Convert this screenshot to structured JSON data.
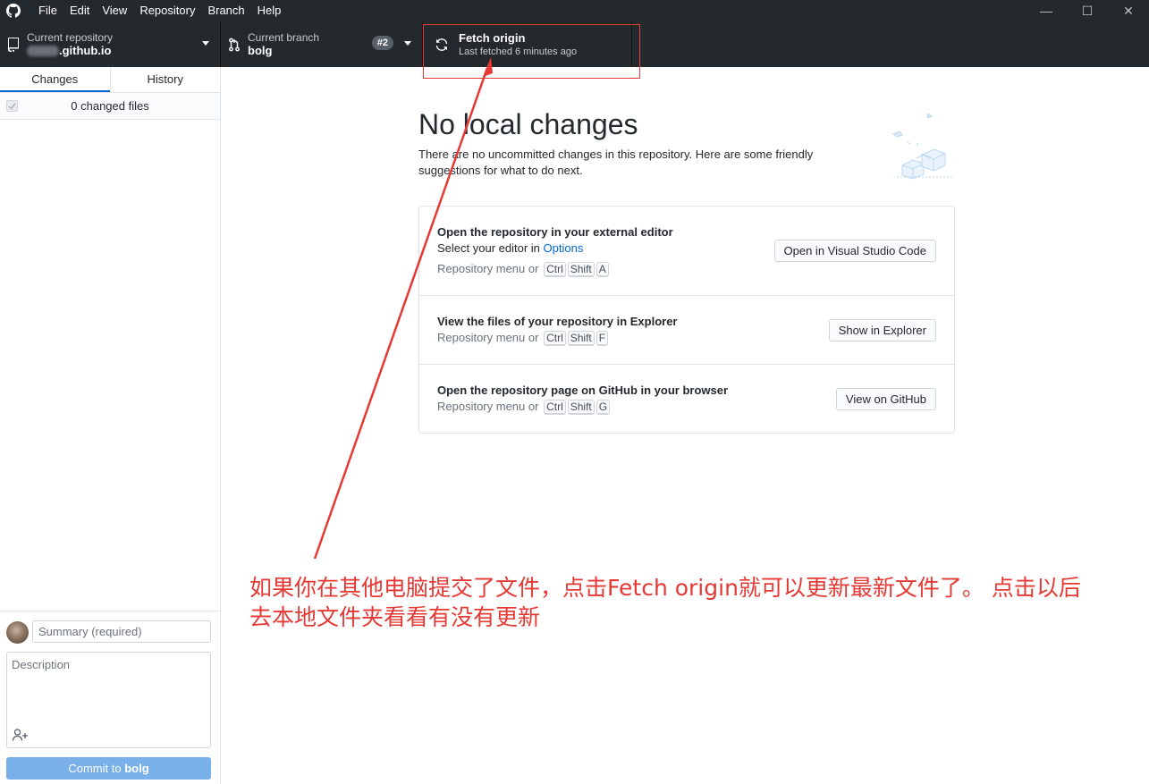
{
  "menu": [
    "File",
    "Edit",
    "View",
    "Repository",
    "Branch",
    "Help"
  ],
  "window_controls": {
    "minimize": "—",
    "maximize": "☐",
    "close": "✕"
  },
  "toolbar": {
    "repo_label": "Current repository",
    "repo_name": ".github.io",
    "branch_label": "Current branch",
    "branch_name": "bolg",
    "pr_badge": "#2",
    "fetch_title": "Fetch origin",
    "fetch_sub": "Last fetched 6 minutes ago"
  },
  "sidebar": {
    "tabs": [
      "Changes",
      "History"
    ],
    "changed_files": "0 changed files",
    "summary_placeholder": "Summary (required)",
    "description_placeholder": "Description",
    "commit_prefix": "Commit to ",
    "commit_branch": "bolg"
  },
  "main": {
    "heading": "No local changes",
    "subtext": "There are no uncommitted changes in this repository. Here are some friendly suggestions for what to do next.",
    "actions": [
      {
        "title": "Open the repository in your external editor",
        "desc_prefix": "Select your editor in ",
        "desc_link": "Options",
        "shortcut_prefix": "Repository menu or",
        "keys": [
          "Ctrl",
          "Shift",
          "A"
        ],
        "button": "Open in Visual Studio Code"
      },
      {
        "title": "View the files of your repository in Explorer",
        "shortcut_prefix": "Repository menu or",
        "keys": [
          "Ctrl",
          "Shift",
          "F"
        ],
        "button": "Show in Explorer"
      },
      {
        "title": "Open the repository page on GitHub in your browser",
        "shortcut_prefix": "Repository menu or",
        "keys": [
          "Ctrl",
          "Shift",
          "G"
        ],
        "button": "View on GitHub"
      }
    ]
  },
  "annotation": {
    "text": "如果你在其他电脑提交了文件，点击Fetch origin就可以更新最新文件了。 点击以后\n去本地文件夹看看有没有更新",
    "color": "#e53935"
  },
  "colors": {
    "toolbar_bg": "#24292e",
    "accent": "#0366d6",
    "commit_button": "#79b0ea"
  }
}
